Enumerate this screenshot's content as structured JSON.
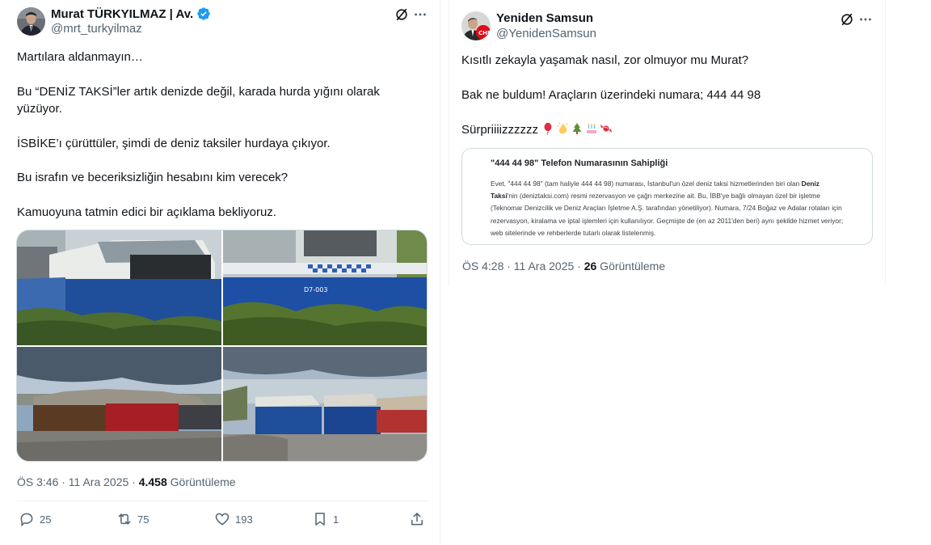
{
  "left_tweet": {
    "author": {
      "name": "Murat TÜRKYILMAZ | Av.",
      "handle": "@mrt_turkyilmaz"
    },
    "text": {
      "line1": "Martılara aldanmayın…",
      "line2": "Bu “DENİZ TAKSİ”ler artık denizde değil, karada hurda yığını olarak\nyüzüyor.",
      "line3": "İSBİKE’ı çürüttüler, şimdi de deniz taksiler hurdaya çıkıyor.",
      "line4": "Bu israfın ve beceriksizliğin hesabını kim verecek?",
      "line5": "Kamuoyuna tatmin edici bir açıklama bekliyoruz."
    },
    "media_labels": {
      "boat_code": "D7-003"
    },
    "meta": {
      "time": "ÖS 3:46 · 11 Ara 2025 · ",
      "views": "4.458",
      "views_label": " Görüntüleme"
    },
    "actions": {
      "replies": "25",
      "reposts": "75",
      "likes": "193",
      "bookmarks": "1"
    }
  },
  "right_tweet": {
    "author": {
      "name": "Yeniden Samsun",
      "handle": "@YenidenSamsun",
      "avatar_badge": "CHP"
    },
    "text": {
      "line1": "Kısıtlı zekayla yaşamak nasıl, zor olmuyor mu Murat?",
      "line2": "Bak ne buldum! Araçların üzerindeki numara; 444 44 98",
      "line3": "Sürpriiiizzzzzz"
    },
    "quote": {
      "title": "\"444 44 98\" Telefon Numarasının Sahipliği",
      "body_part1": "Evet, \"444 44 98\" (tam haliyle 444 44 98) numarası, İstanbul'un özel deniz taksi hizmetlerinden biri olan ",
      "body_bold": "Deniz Taksi",
      "body_part2": "'nin (deniztaksi.com) resmi rezervasyon ve çağrı merkezine ait. Bu, İBB'ye bağlı olmayan özel bir işletme (Teknomar Denizcilik ve Deniz Araçları İşletme A.Ş. tarafından yönetiliyor). Numara, 7/24 Boğaz ve Adalar rotaları için rezervasyon, kiralama ve iptal işlemleri için kullanılıyor. Geçmişte de (en az 2011'den beri) aynı şekilde hizmet veriyor; web sitelerinde ve rehberlerde tutarlı olarak listelenmiş."
    },
    "meta": {
      "time": "ÖS 4:28 · 11 Ara 2025 · ",
      "views": "26",
      "views_label": " Görüntüleme"
    }
  },
  "colors": {
    "verified": "#1d9bf0",
    "secondary_text": "#536471",
    "border": "#cfd9de",
    "chp_red": "#e30a17"
  },
  "icons": [
    "grok-icon",
    "more-icon",
    "reply-icon",
    "repost-icon",
    "like-icon",
    "bookmark-icon",
    "share-icon",
    "verified-badge-icon"
  ]
}
